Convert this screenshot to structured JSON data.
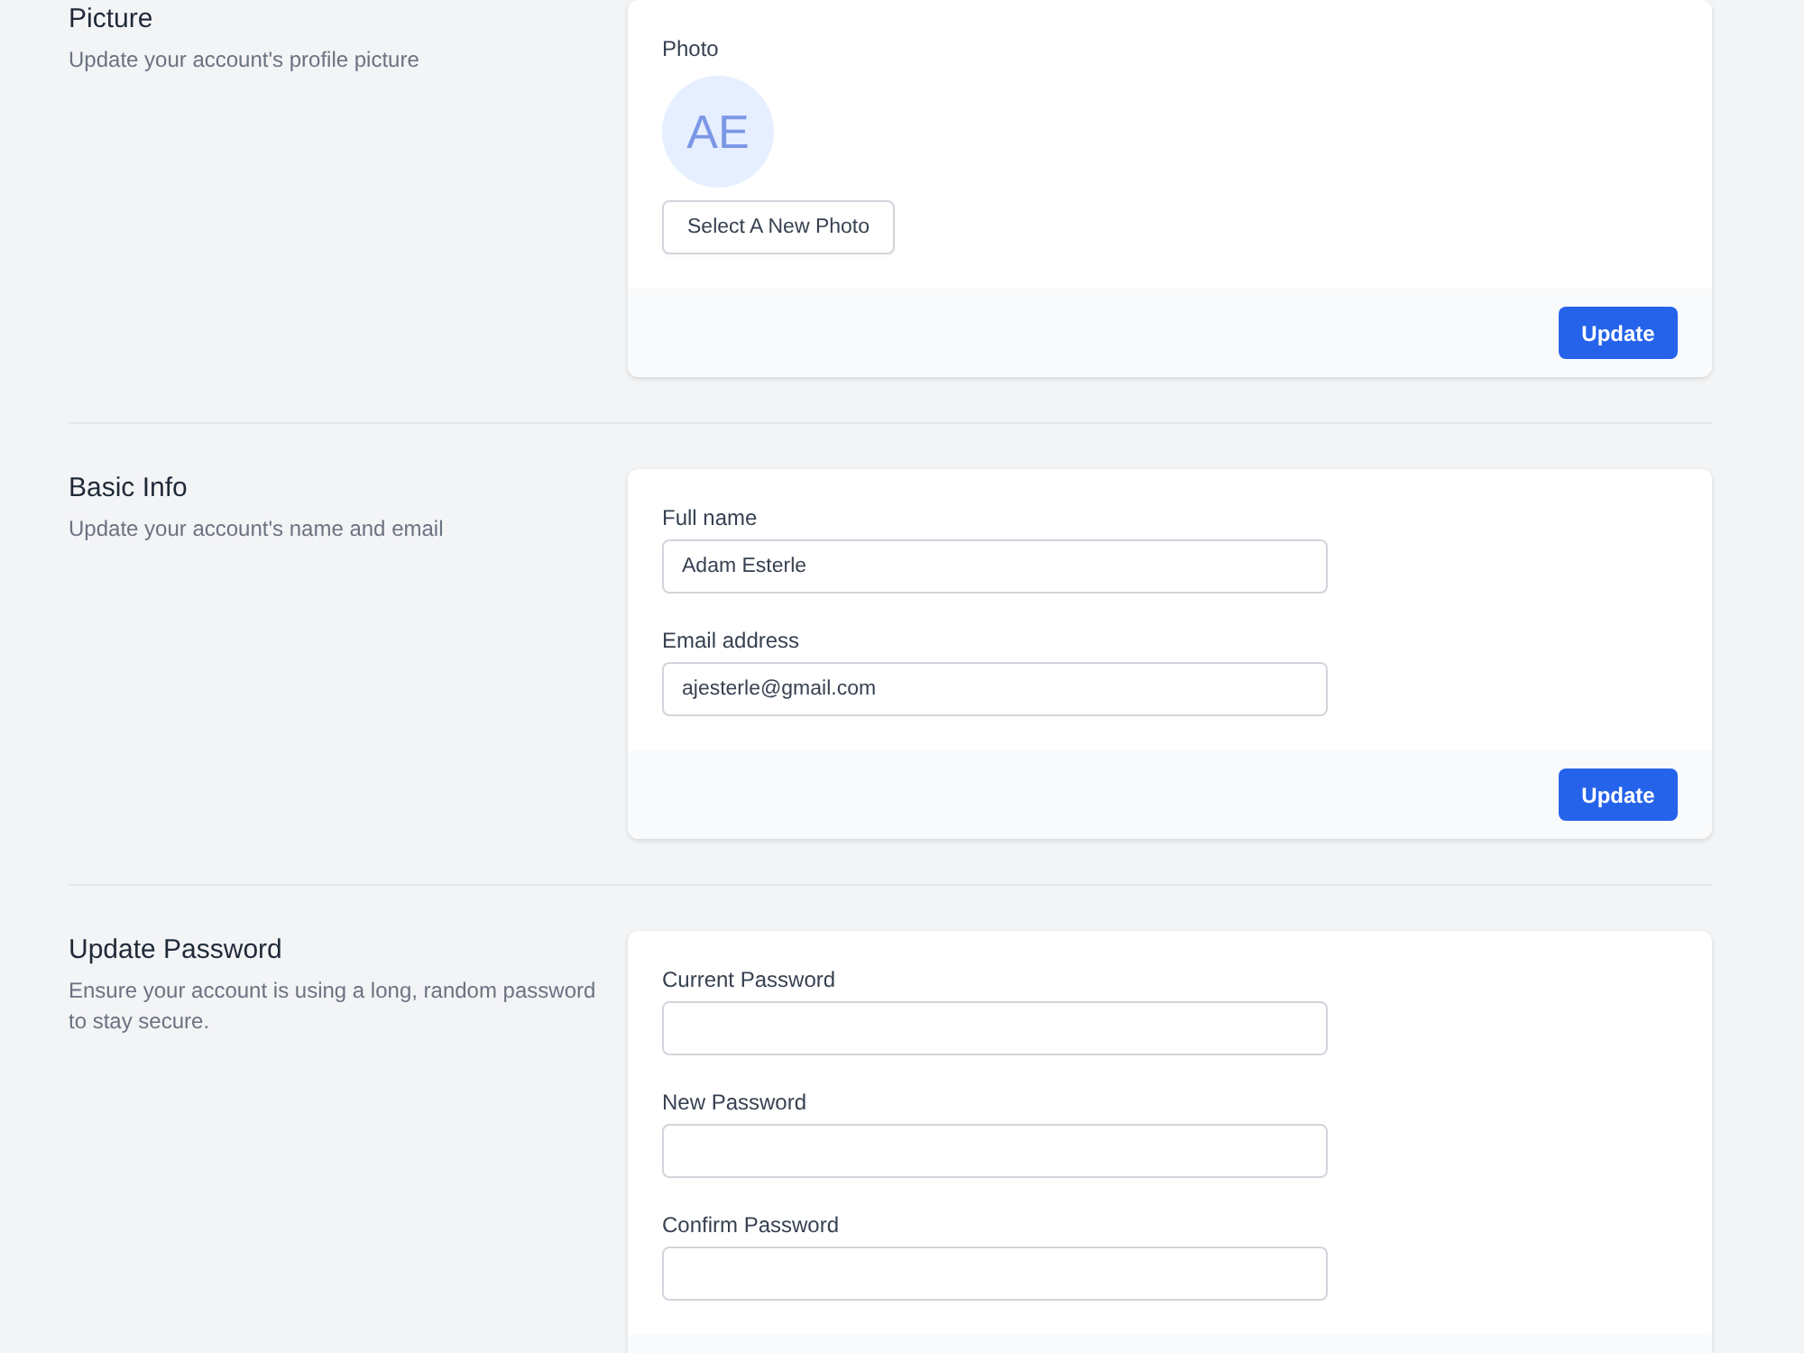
{
  "sections": [
    {
      "kind": "photo",
      "title": "Picture",
      "description": "Update your account's profile picture",
      "photo": {
        "label": "Photo",
        "initials": "AE",
        "button": "Select A New Photo"
      },
      "submit": "Update"
    },
    {
      "kind": "fields",
      "title": "Basic Info",
      "description": "Update your account's name and email",
      "fields": [
        {
          "label": "Full name",
          "value": "Adam Esterle"
        },
        {
          "label": "Email address",
          "value": "ajesterle@gmail.com"
        }
      ],
      "submit": "Update"
    },
    {
      "kind": "fields",
      "title": "Update Password",
      "description": "Ensure your account is using a long, random password to stay secure.",
      "fields": [
        {
          "label": "Current Password"
        },
        {
          "label": "New Password"
        },
        {
          "label": "Confirm Password"
        }
      ]
    }
  ]
}
